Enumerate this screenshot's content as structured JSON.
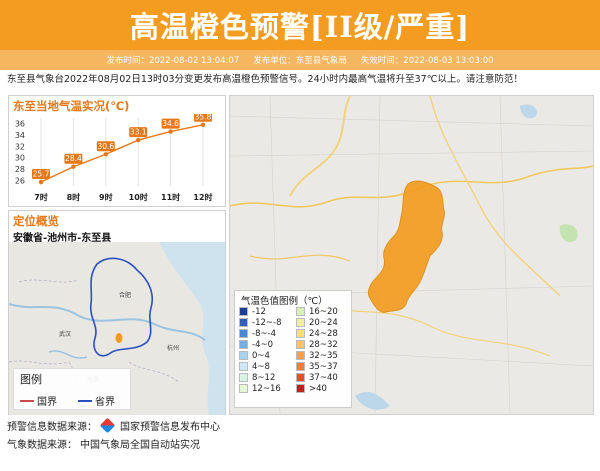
{
  "banner": {
    "title": "高温橙色预警[II级/严重]"
  },
  "meta": {
    "publish_time_label": "发布时间：",
    "publish_time": "2022-08-02 13:04:07",
    "publisher_label": "发布单位：",
    "publisher": "东至县气象局",
    "expire_label": "失效时间：",
    "expire_time": "2022-08-03 13:03:00"
  },
  "description": "东至县气象台2022年08月02日13时03分变更发布高温橙色预警信号。24小时内最高气温将升至37℃以上。请注意防范！",
  "temp_panel": {
    "title": "东至当地气温实况(℃)"
  },
  "chart_data": {
    "type": "line",
    "title": "东至当地气温实况(℃)",
    "categories": [
      "7时",
      "8时",
      "9时",
      "10时",
      "11时",
      "12时"
    ],
    "series": [
      {
        "values": [
          25.7,
          28.4,
          30.6,
          33.1,
          34.6,
          35.8
        ]
      }
    ],
    "yticks": [
      26,
      28,
      30,
      32,
      34,
      36
    ],
    "ylim": [
      25,
      37
    ],
    "grid": true,
    "colors": {
      "line": "#e77817",
      "label_bg": "#e77817",
      "label_fg": "#ffffff"
    }
  },
  "location_panel": {
    "title": "定位概览",
    "location": "安徽省-池州市-东至县",
    "map_labels": [
      "合肥",
      "武汉",
      "南昌",
      "杭州"
    ],
    "legend": {
      "title": "图例",
      "items": [
        {
          "label": "国界",
          "color": "#c94a4a"
        },
        {
          "label": "省界",
          "color": "#2a4fbf"
        }
      ]
    }
  },
  "main_map": {
    "legend_title": "气温色值图例（℃）",
    "scale": [
      {
        "label": "-12",
        "color": "#1c3f94"
      },
      {
        "label": "16~20",
        "color": "#d6f0b8"
      },
      {
        "label": "-12~-8",
        "color": "#2f5fb8"
      },
      {
        "label": "20~24",
        "color": "#f2efa0"
      },
      {
        "label": "-8~-4",
        "color": "#4a87d2"
      },
      {
        "label": "24~28",
        "color": "#f7e07a"
      },
      {
        "label": "-4~0",
        "color": "#74aee4"
      },
      {
        "label": "28~32",
        "color": "#f9c46b"
      },
      {
        "label": "0~4",
        "color": "#a7d3f2"
      },
      {
        "label": "32~35",
        "color": "#f7a04e"
      },
      {
        "label": "4~8",
        "color": "#cfe8f7"
      },
      {
        "label": "35~37",
        "color": "#f07c3a"
      },
      {
        "label": "8~12",
        "color": "#d9f2e6"
      },
      {
        "label": "37~40",
        "color": "#e0512a"
      },
      {
        "label": "12~16",
        "color": "#e6f7d8"
      },
      {
        "label": ">40",
        "color": "#c81e1e"
      }
    ],
    "region_color": "#f39c1f"
  },
  "footer": {
    "warning_source_label": "预警信息数据来源：",
    "warning_source": "国家预警信息发布中心",
    "weather_source_label": "气象数据来源：",
    "weather_source": "中国气象局全国自动站实况"
  }
}
